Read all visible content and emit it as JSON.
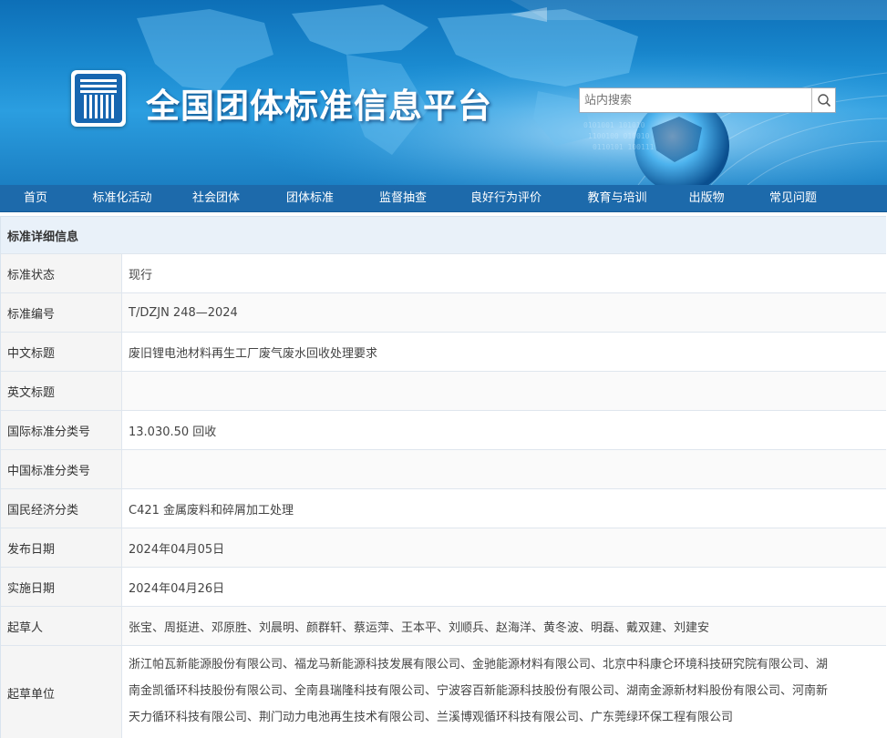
{
  "site": {
    "title": "全国团体标准信息平台",
    "logo_icon": "standards-logo-icon",
    "search_placeholder": "站内搜索",
    "search_icon": "search-icon"
  },
  "nav": {
    "items": [
      "首页",
      "标准化活动",
      "社会团体",
      "团体标准",
      "监督抽查",
      "良好行为评价",
      "教育与培训",
      "出版物",
      "常见问题"
    ]
  },
  "detail": {
    "header": "标准详细信息",
    "rows": [
      {
        "label": "标准状态",
        "value": "现行"
      },
      {
        "label": "标准编号",
        "value": "T/DZJN 248—2024"
      },
      {
        "label": "中文标题",
        "value": "废旧锂电池材料再生工厂废气废水回收处理要求"
      },
      {
        "label": "英文标题",
        "value": ""
      },
      {
        "label": "国际标准分类号",
        "value": "13.030.50 回收"
      },
      {
        "label": "中国标准分类号",
        "value": ""
      },
      {
        "label": "国民经济分类",
        "value": "C421 金属废料和碎屑加工处理"
      },
      {
        "label": "发布日期",
        "value": "2024年04月05日"
      },
      {
        "label": "实施日期",
        "value": "2024年04月26日"
      },
      {
        "label": "起草人",
        "value": "张宝、周挺进、邓原胜、刘晨明、颜群轩、蔡运萍、王本平、刘顺兵、赵海洋、黄冬波、明磊、戴双建、刘建安"
      }
    ],
    "drafting_unit": {
      "label": "起草单位",
      "lines": [
        "浙江帕瓦新能源股份有限公司、福龙马新能源科技发展有限公司、金驰能源材料有限公司、北京中科康仑环境科技研究院有限公司、湖",
        "南金凯循环科技股份有限公司、全南县瑞隆科技有限公司、宁波容百新能源科技股份有限公司、湖南金源新材料股份有限公司、河南新",
        "天力循环科技有限公司、荆门动力电池再生技术有限公司、兰溪博观循环科技有限公司、广东莞绿环保工程有限公司"
      ]
    }
  },
  "colors": {
    "nav_bg": "#1d6aab",
    "header_row_bg": "#e9f1f9",
    "label_bg": "#f5f5f5"
  }
}
